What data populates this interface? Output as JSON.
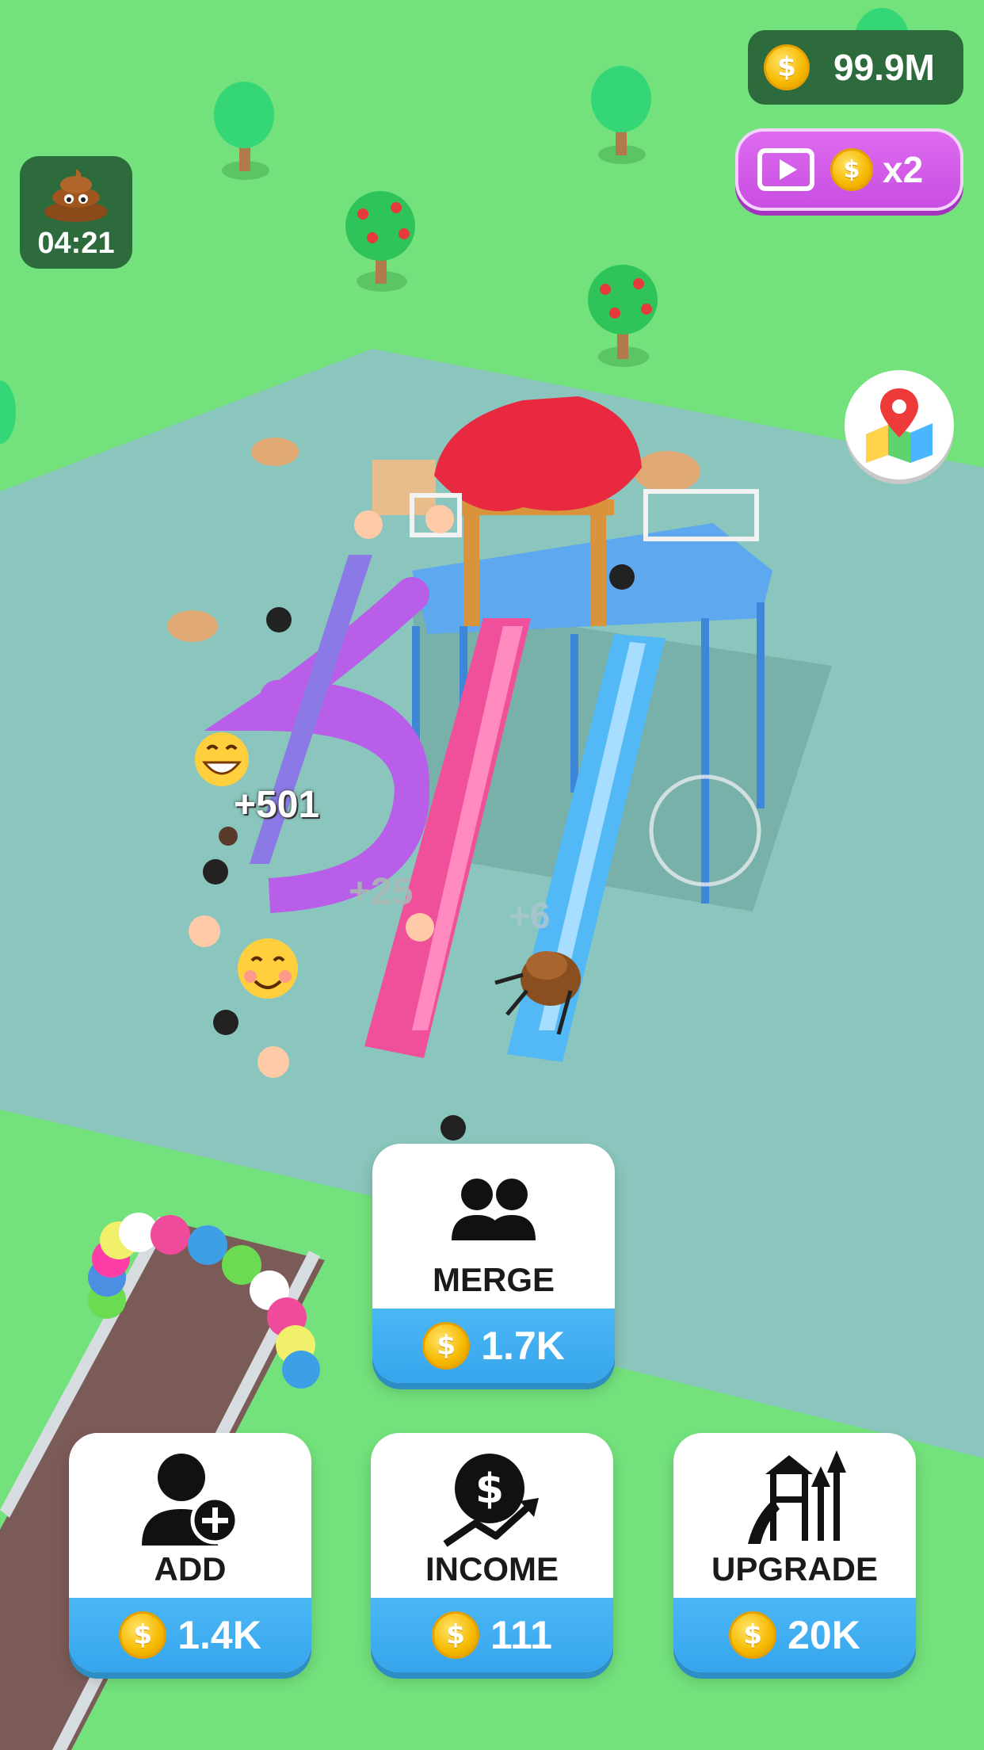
{
  "hud": {
    "coins": "99.9M",
    "ad_multiplier": "x2",
    "timer": "04:21"
  },
  "floating_texts": [
    "+501",
    "+25",
    "+6"
  ],
  "buttons": {
    "merge": {
      "label": "MERGE",
      "price": "1.7K"
    },
    "add": {
      "label": "ADD",
      "price": "1.4K"
    },
    "income": {
      "label": "INCOME",
      "price": "111"
    },
    "upgrade": {
      "label": "UPGRADE",
      "price": "20K"
    }
  },
  "colors": {
    "grass": "#73e27c",
    "plaza": "#8ac6bd",
    "path": "#7b5b57",
    "button_blue": "#36a5ec",
    "ad_purple": "#c84ee2",
    "hud_dark": "#2d6a3c"
  },
  "icons": {
    "coin": "coin-icon",
    "ad": "video-play-icon",
    "poop": "poop-icon",
    "map": "map-pin-icon",
    "merge": "users-icon",
    "add": "add-user-icon",
    "income": "dollar-growth-icon",
    "upgrade": "playground-upgrade-icon"
  }
}
